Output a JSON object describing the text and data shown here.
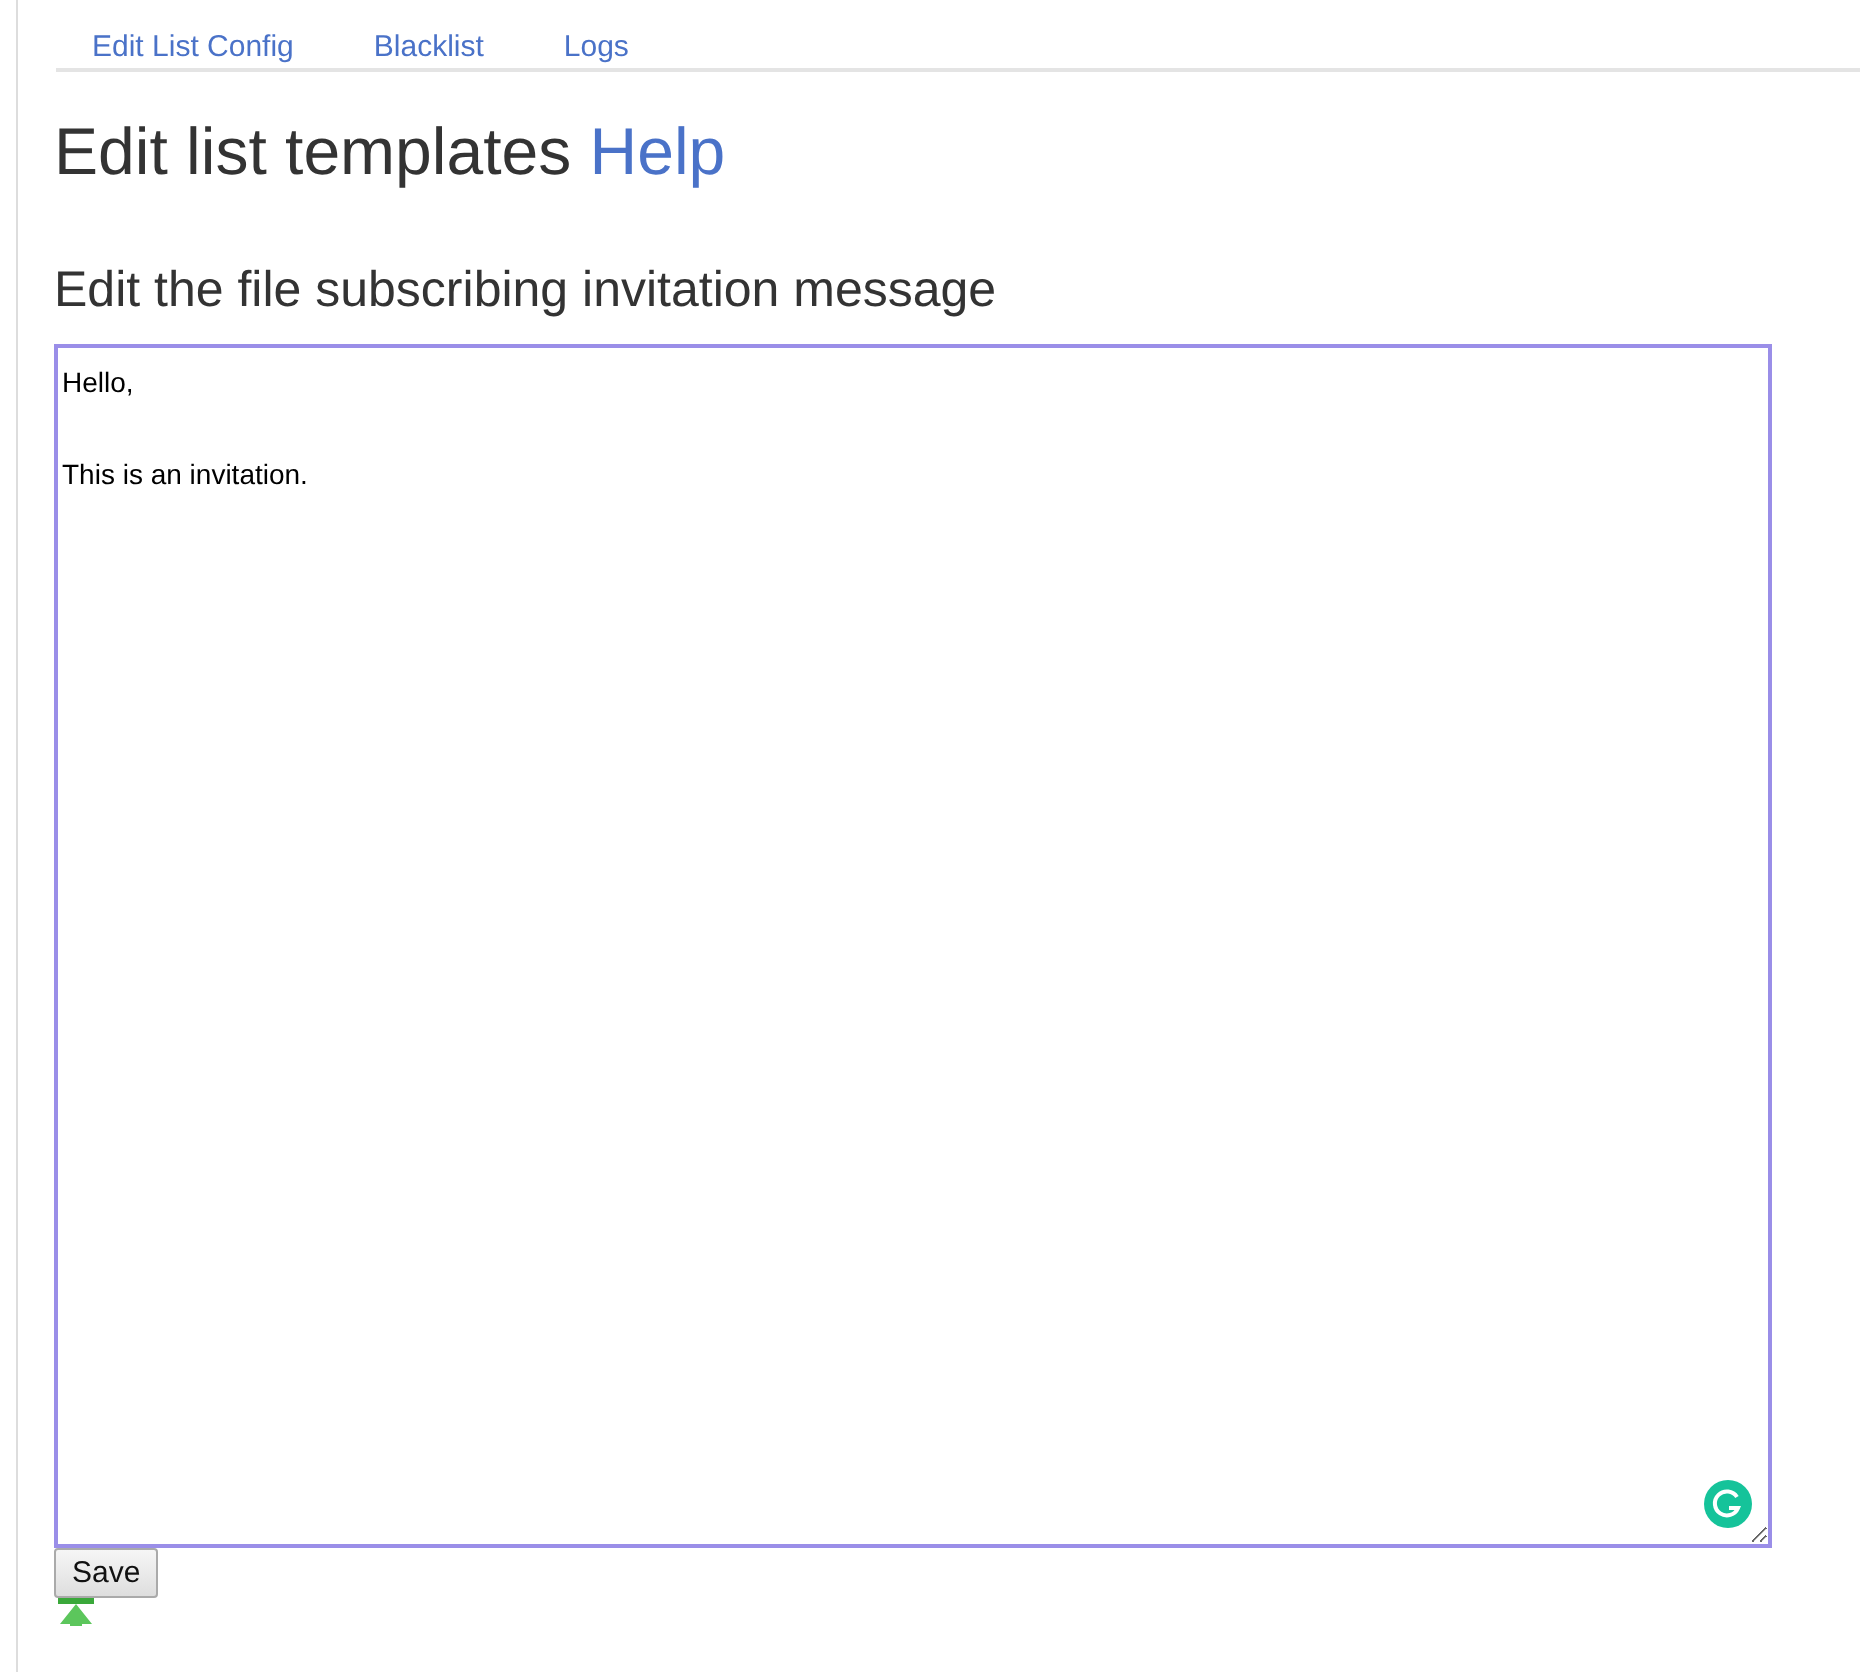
{
  "nav": [
    {
      "label": "Edit List Config"
    },
    {
      "label": "Blacklist"
    },
    {
      "label": "Logs"
    }
  ],
  "title": {
    "text": "Edit list templates",
    "link": "Help"
  },
  "subtitle": "Edit the file subscribing invitation message",
  "editor": {
    "value": "Hello,\n\nThis is an invitation."
  },
  "save_button": "Save"
}
